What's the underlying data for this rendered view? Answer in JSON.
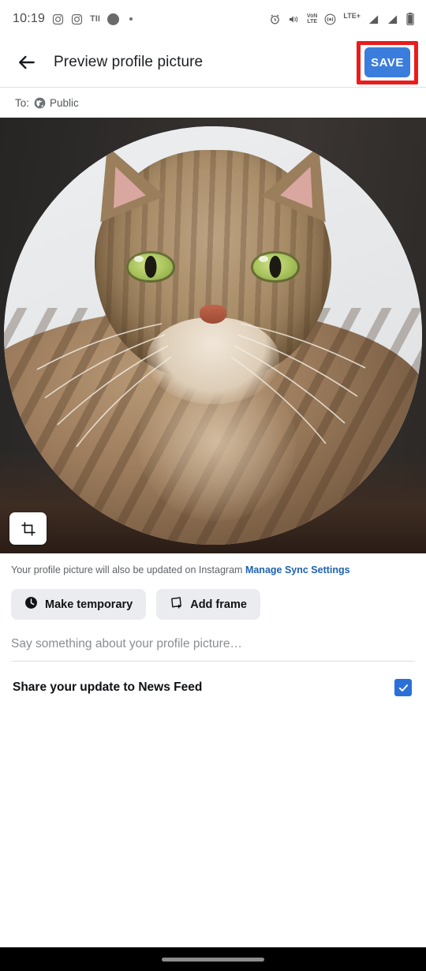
{
  "status_bar": {
    "time": "10:19",
    "left_icons": [
      "instagram-icon",
      "instagram-icon",
      "tii-text-icon",
      "blob-icon",
      "dot-icon"
    ],
    "tii_label": "TII",
    "right_icons": [
      "alarm-icon",
      "vibrate-icon",
      "volte-icon",
      "hotspot-icon",
      "lte-plus-icon",
      "signal-icon",
      "signal-icon",
      "battery-icon"
    ],
    "volte_line1": "VoN",
    "volte_line2": "LTE",
    "lte_label": "LTE+"
  },
  "header": {
    "back_icon": "back-arrow-icon",
    "title": "Preview profile picture",
    "save_label": "SAVE",
    "save_bg": "#3b7ddd",
    "highlight_color": "#ea1c1c"
  },
  "audience": {
    "to_label": "To:",
    "globe_icon": "globe-icon",
    "value": "Public"
  },
  "photo": {
    "subject": "tabby-cat-photo",
    "crop_icon": "crop-icon"
  },
  "sync": {
    "text": "Your profile picture will also be updated on Instagram ",
    "link_label": "Manage Sync Settings",
    "link_color": "#1d62b0"
  },
  "chips": [
    {
      "icon": "clock-icon",
      "label": "Make temporary"
    },
    {
      "icon": "frame-icon",
      "label": "Add frame"
    }
  ],
  "caption": {
    "placeholder": "Say something about your profile picture…",
    "value": ""
  },
  "news_feed": {
    "label": "Share your update to News Feed",
    "checked": true,
    "checkbox_color": "#2a70d8",
    "check_icon": "checkmark-icon"
  },
  "nav_bar": {
    "handle": "home-gesture-pill"
  }
}
